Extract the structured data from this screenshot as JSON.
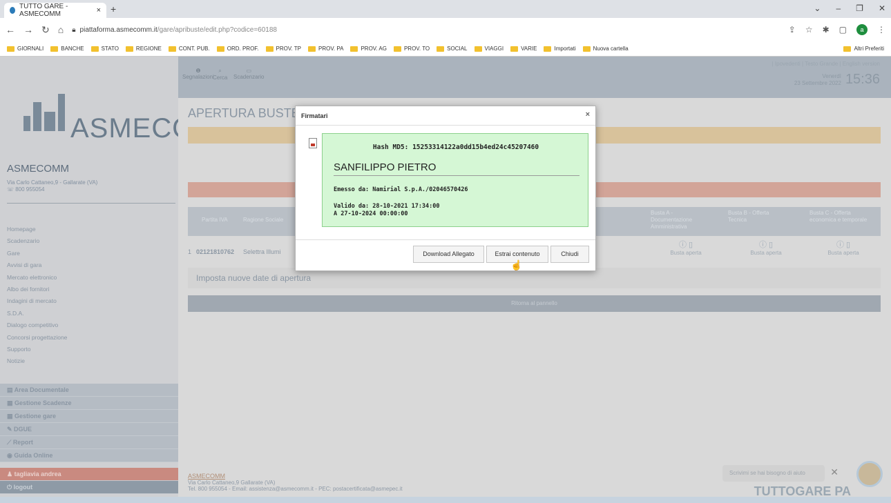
{
  "browser": {
    "tab_title": "TUTTO GARE - ASMECOMM",
    "tab_close": "×",
    "new_tab": "+",
    "url_host": "piattaforma.asmecomm.it",
    "url_path": "/gare/apribuste/edit.php?codice=60188",
    "bookmarks": [
      "GIORNALI",
      "BANCHE",
      "STATO",
      "REGIONE",
      "CONT. PUB.",
      "ORD. PROF.",
      "PROV. TP",
      "PROV. PA",
      "PROV. AG",
      "PROV. TO",
      "SOCIAL",
      "VIAGGI",
      "VARIE",
      "Importati",
      "Nuova cartella"
    ],
    "bookmarks_other": "Altri Preferiti",
    "profile_initial": "a"
  },
  "sidebar": {
    "logo_text": "ASMECOMM",
    "org_name": "ASMECOMM",
    "org_address": "Via Carlo Cattaneo,9 - Gallarate (VA)",
    "org_phone": "800 955054",
    "menu": [
      "Homepage",
      "Scadenzario",
      "Gare",
      "Avvisi di gara",
      "Mercato elettronico",
      "Albo dei fornitori",
      "Indagini di mercato",
      "S.D.A.",
      "Dialogo competitivo",
      "Concorsi progettazione",
      "Supporto",
      "Notizie"
    ],
    "sections": [
      "Area Documentale",
      "Gestione Scadenze",
      "Gestione gare",
      "DGUE",
      "Report",
      "Guida Online"
    ],
    "user": "tagliavia andrea",
    "logout": "logout"
  },
  "topbar": {
    "icons": [
      "Segnalazioni",
      "Cerca",
      "Scadenzario"
    ],
    "links": "| Ipovedenti | Testo Grande | English version",
    "day": "Venerdì",
    "date": "23 Settembre 2022",
    "time": "15:36"
  },
  "main": {
    "title": "APERTURA BUSTE",
    "table_headers": {
      "piva": "Partita IVA",
      "ragione": "Ragione Sociale",
      "busta_a": "Busta A - Documentazione Amministrativa",
      "busta_b": "Busta B - Offerta Tecnica",
      "busta_c": "Busta C - Offerta economica e temporale"
    },
    "row": {
      "num": "1",
      "piva": "02121810762",
      "ragione": "Selettra Illumi",
      "status_a": "Busta aperta",
      "status_b": "Busta aperta",
      "status_c": "Busta aperta"
    },
    "new_dates": "Imposta nuove date di apertura",
    "back": "Ritorna al pannello"
  },
  "footer": {
    "name": "ASMECOMM",
    "address": "Via Carlo Cattaneo,9 Gallarate (VA)",
    "contacts": "Tel. 800 955054 - Email: assistenza@asmecomm.it - PEC: postacertificata@asmepec.it",
    "chat": "Scrivimi se hai bisogno di aiuto",
    "chat_close": "✕",
    "brand": "TUTTOGARE PA"
  },
  "modal": {
    "title": "Firmatari",
    "close": "×",
    "hash": "Hash MD5: 15253314122a0dd15b4ed24c45207460",
    "signer": "SANFILIPPO PIETRO",
    "issuer": "Emesso da: Namirial S.p.A./02046570426",
    "valid_from": "Valido da: 28-10-2021 17:34:00",
    "valid_to": "A 27-10-2024 00:00:00",
    "buttons": {
      "download": "Download Allegato",
      "extract": "Estrai contenuto",
      "close": "Chiudi"
    }
  }
}
